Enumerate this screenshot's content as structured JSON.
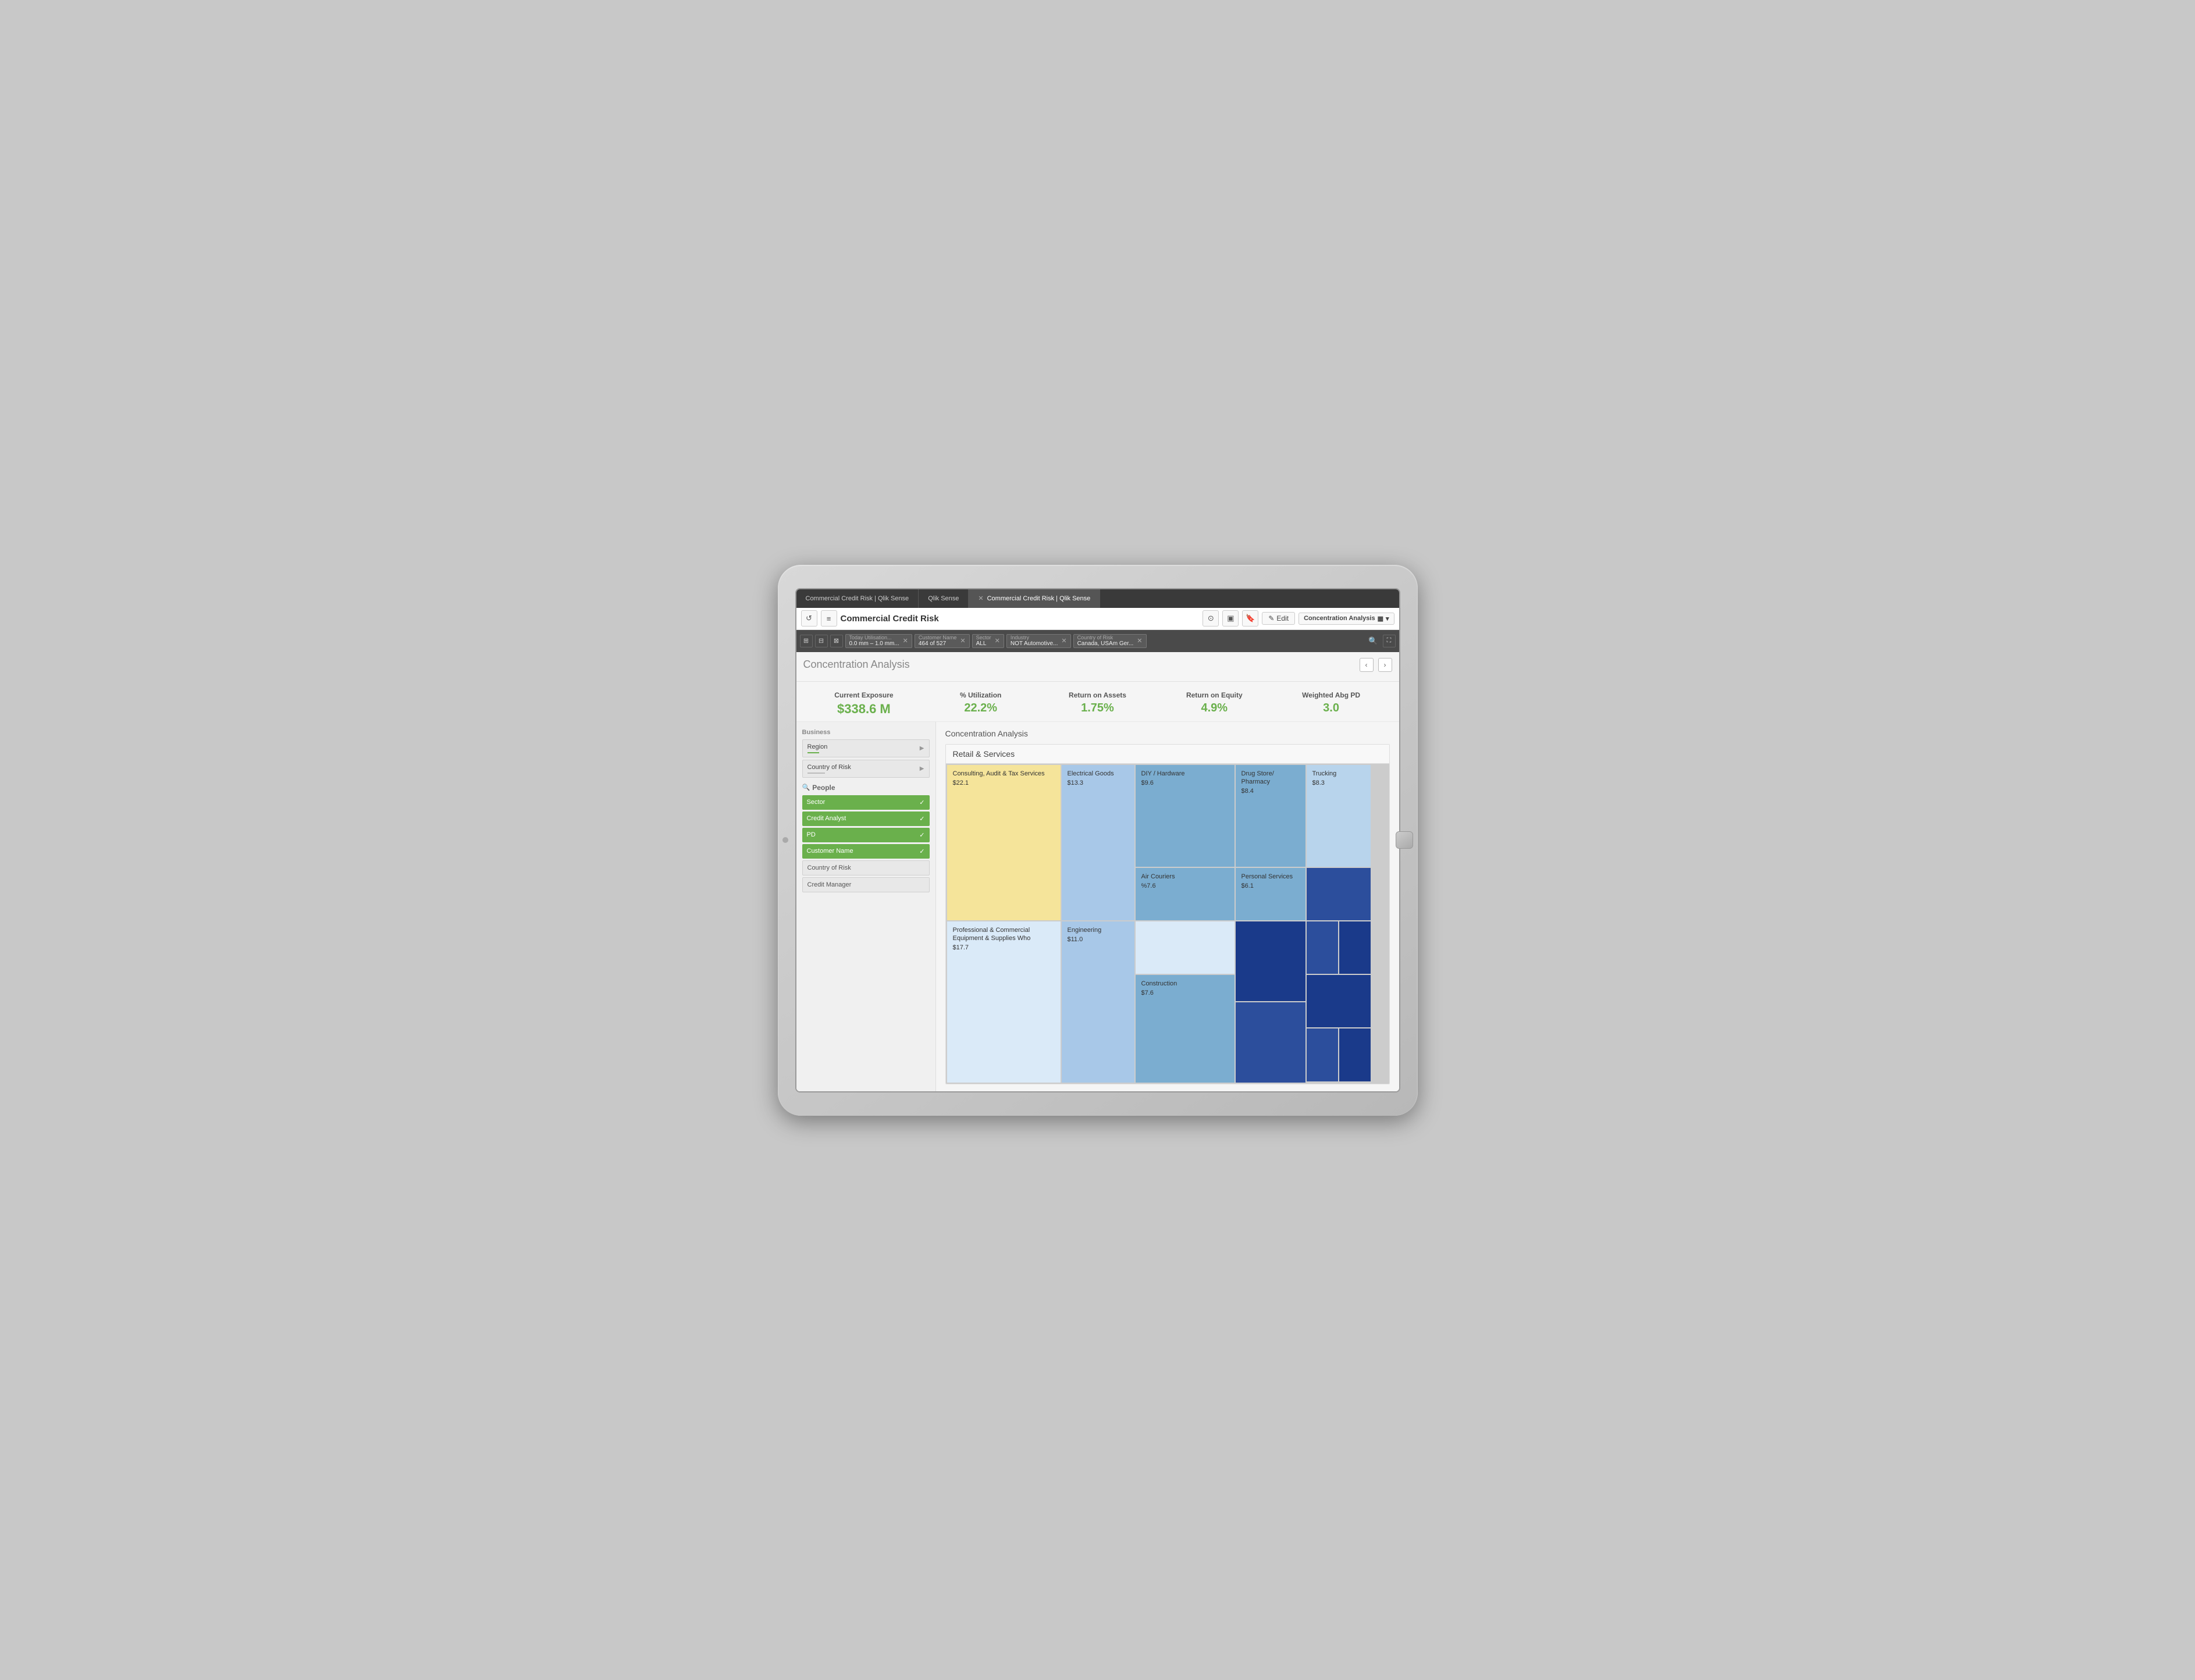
{
  "tablet": {
    "browser": {
      "tabs": [
        {
          "label": "Commercial Credit Risk | Qlik Sense",
          "active": false
        },
        {
          "label": "Qlik Sense",
          "active": false
        },
        {
          "label": "Commercial Credit Risk | Qlik Sense",
          "active": true
        }
      ],
      "tab_close": "✕"
    },
    "toolbar": {
      "back_icon": "↺",
      "menu_icon": "≡",
      "app_title": "Commercial Credit Risk",
      "camera_icon": "📷",
      "monitor_icon": "⊡",
      "bookmark_icon": "🔖",
      "edit_icon": "✎",
      "edit_label": "Edit",
      "sheet_label": "Concentration Analysis",
      "chart_icon": "▦",
      "dropdown_icon": "▾"
    },
    "filter_bar": {
      "icon1": "⊞",
      "icon2": "⊟",
      "icon3": "⊠",
      "chips": [
        {
          "title": "Today Utilisation...",
          "value": "0.0 mm – 1.0 mm..."
        },
        {
          "title": "Customer Name",
          "value": "464 of 527"
        },
        {
          "title": "Sector",
          "value": "ALL"
        },
        {
          "title": "Industry",
          "value": "NOT Automotive..."
        },
        {
          "title": "Country of Risk",
          "value": "Canada, USAm Ger..."
        }
      ],
      "search_icon": "🔍",
      "fullscreen_icon": "⛶"
    },
    "page": {
      "title": "Concentration Analysis",
      "prev_arrow": "‹",
      "next_arrow": "›"
    },
    "kpis": [
      {
        "label": "Current Exposure",
        "value": "$338.6 M"
      },
      {
        "label": "% Utilization",
        "value": "22.2%"
      },
      {
        "label": "Return on Assets",
        "value": "1.75%"
      },
      {
        "label": "Return on Equity",
        "value": "4.9%"
      },
      {
        "label": "Weighted Abg PD",
        "value": "3.0"
      }
    ],
    "sidebar": {
      "business_label": "Business",
      "list_items": [
        {
          "label": "Region",
          "has_green_bar": true,
          "has_gray_bar": false
        },
        {
          "label": "Country of Risk",
          "has_green_bar": false,
          "has_gray_bar": true
        }
      ],
      "people_label": "People",
      "green_items": [
        {
          "label": "Sector"
        },
        {
          "label": "Credit Analyst"
        },
        {
          "label": "PD"
        },
        {
          "label": "Customer Name"
        }
      ],
      "white_items": [
        {
          "label": "Country of Risk"
        },
        {
          "label": "Credit Manager"
        }
      ]
    },
    "treemap": {
      "section_title": "Concentration Analysis",
      "group_label": "Retail & Services",
      "cells": [
        {
          "name": "Consulting, Audit & Tax Services",
          "value": "$22.1",
          "color": "yellow",
          "col": 1,
          "row": 1,
          "rowspan": 1,
          "colspan": 1
        },
        {
          "name": "Electrical Goods",
          "value": "$13.3",
          "color": "light-blue",
          "col": 2,
          "row": 1,
          "rowspan": 2,
          "colspan": 1
        },
        {
          "name": "DIY / Hardware",
          "value": "$9.6",
          "color": "medium-blue",
          "col": 3,
          "row": 1,
          "rowspan": 1,
          "colspan": 1
        },
        {
          "name": "Drug Store/ Pharmacy",
          "value": "$8.4",
          "color": "medium-blue",
          "col": 4,
          "row": 1,
          "rowspan": 1,
          "colspan": 1
        },
        {
          "name": "Trucking",
          "value": "$8.3",
          "color": "light-blue2",
          "col": 5,
          "row": 1,
          "rowspan": 1,
          "colspan": 1
        },
        {
          "name": "Air Couriers",
          "value": "%7.6",
          "color": "medium-blue",
          "col": 3,
          "row": 2,
          "rowspan": 1,
          "colspan": 1
        },
        {
          "name": "Personal Services",
          "value": "$6.1",
          "color": "medium-blue",
          "col": 4,
          "row": 2,
          "rowspan": 1,
          "colspan": 1
        },
        {
          "name": "small-dark-1",
          "value": "",
          "color": "dark-blue",
          "col": 5,
          "row": 2,
          "rowspan": 1,
          "colspan": 1
        },
        {
          "name": "Professional & Commercial Equipment & Supplies Who",
          "value": "$17.7",
          "color": "very-light-blue",
          "col": 1,
          "row": 2,
          "rowspan": 1,
          "colspan": 1
        },
        {
          "name": "Engineering",
          "value": "$11.0",
          "color": "light-blue",
          "col": 2,
          "row": 3,
          "rowspan": 1,
          "colspan": 1
        },
        {
          "name": "Construction",
          "value": "$7.6",
          "color": "medium-blue",
          "col": 3,
          "row": 3,
          "rowspan": 1,
          "colspan": 1
        }
      ]
    }
  }
}
